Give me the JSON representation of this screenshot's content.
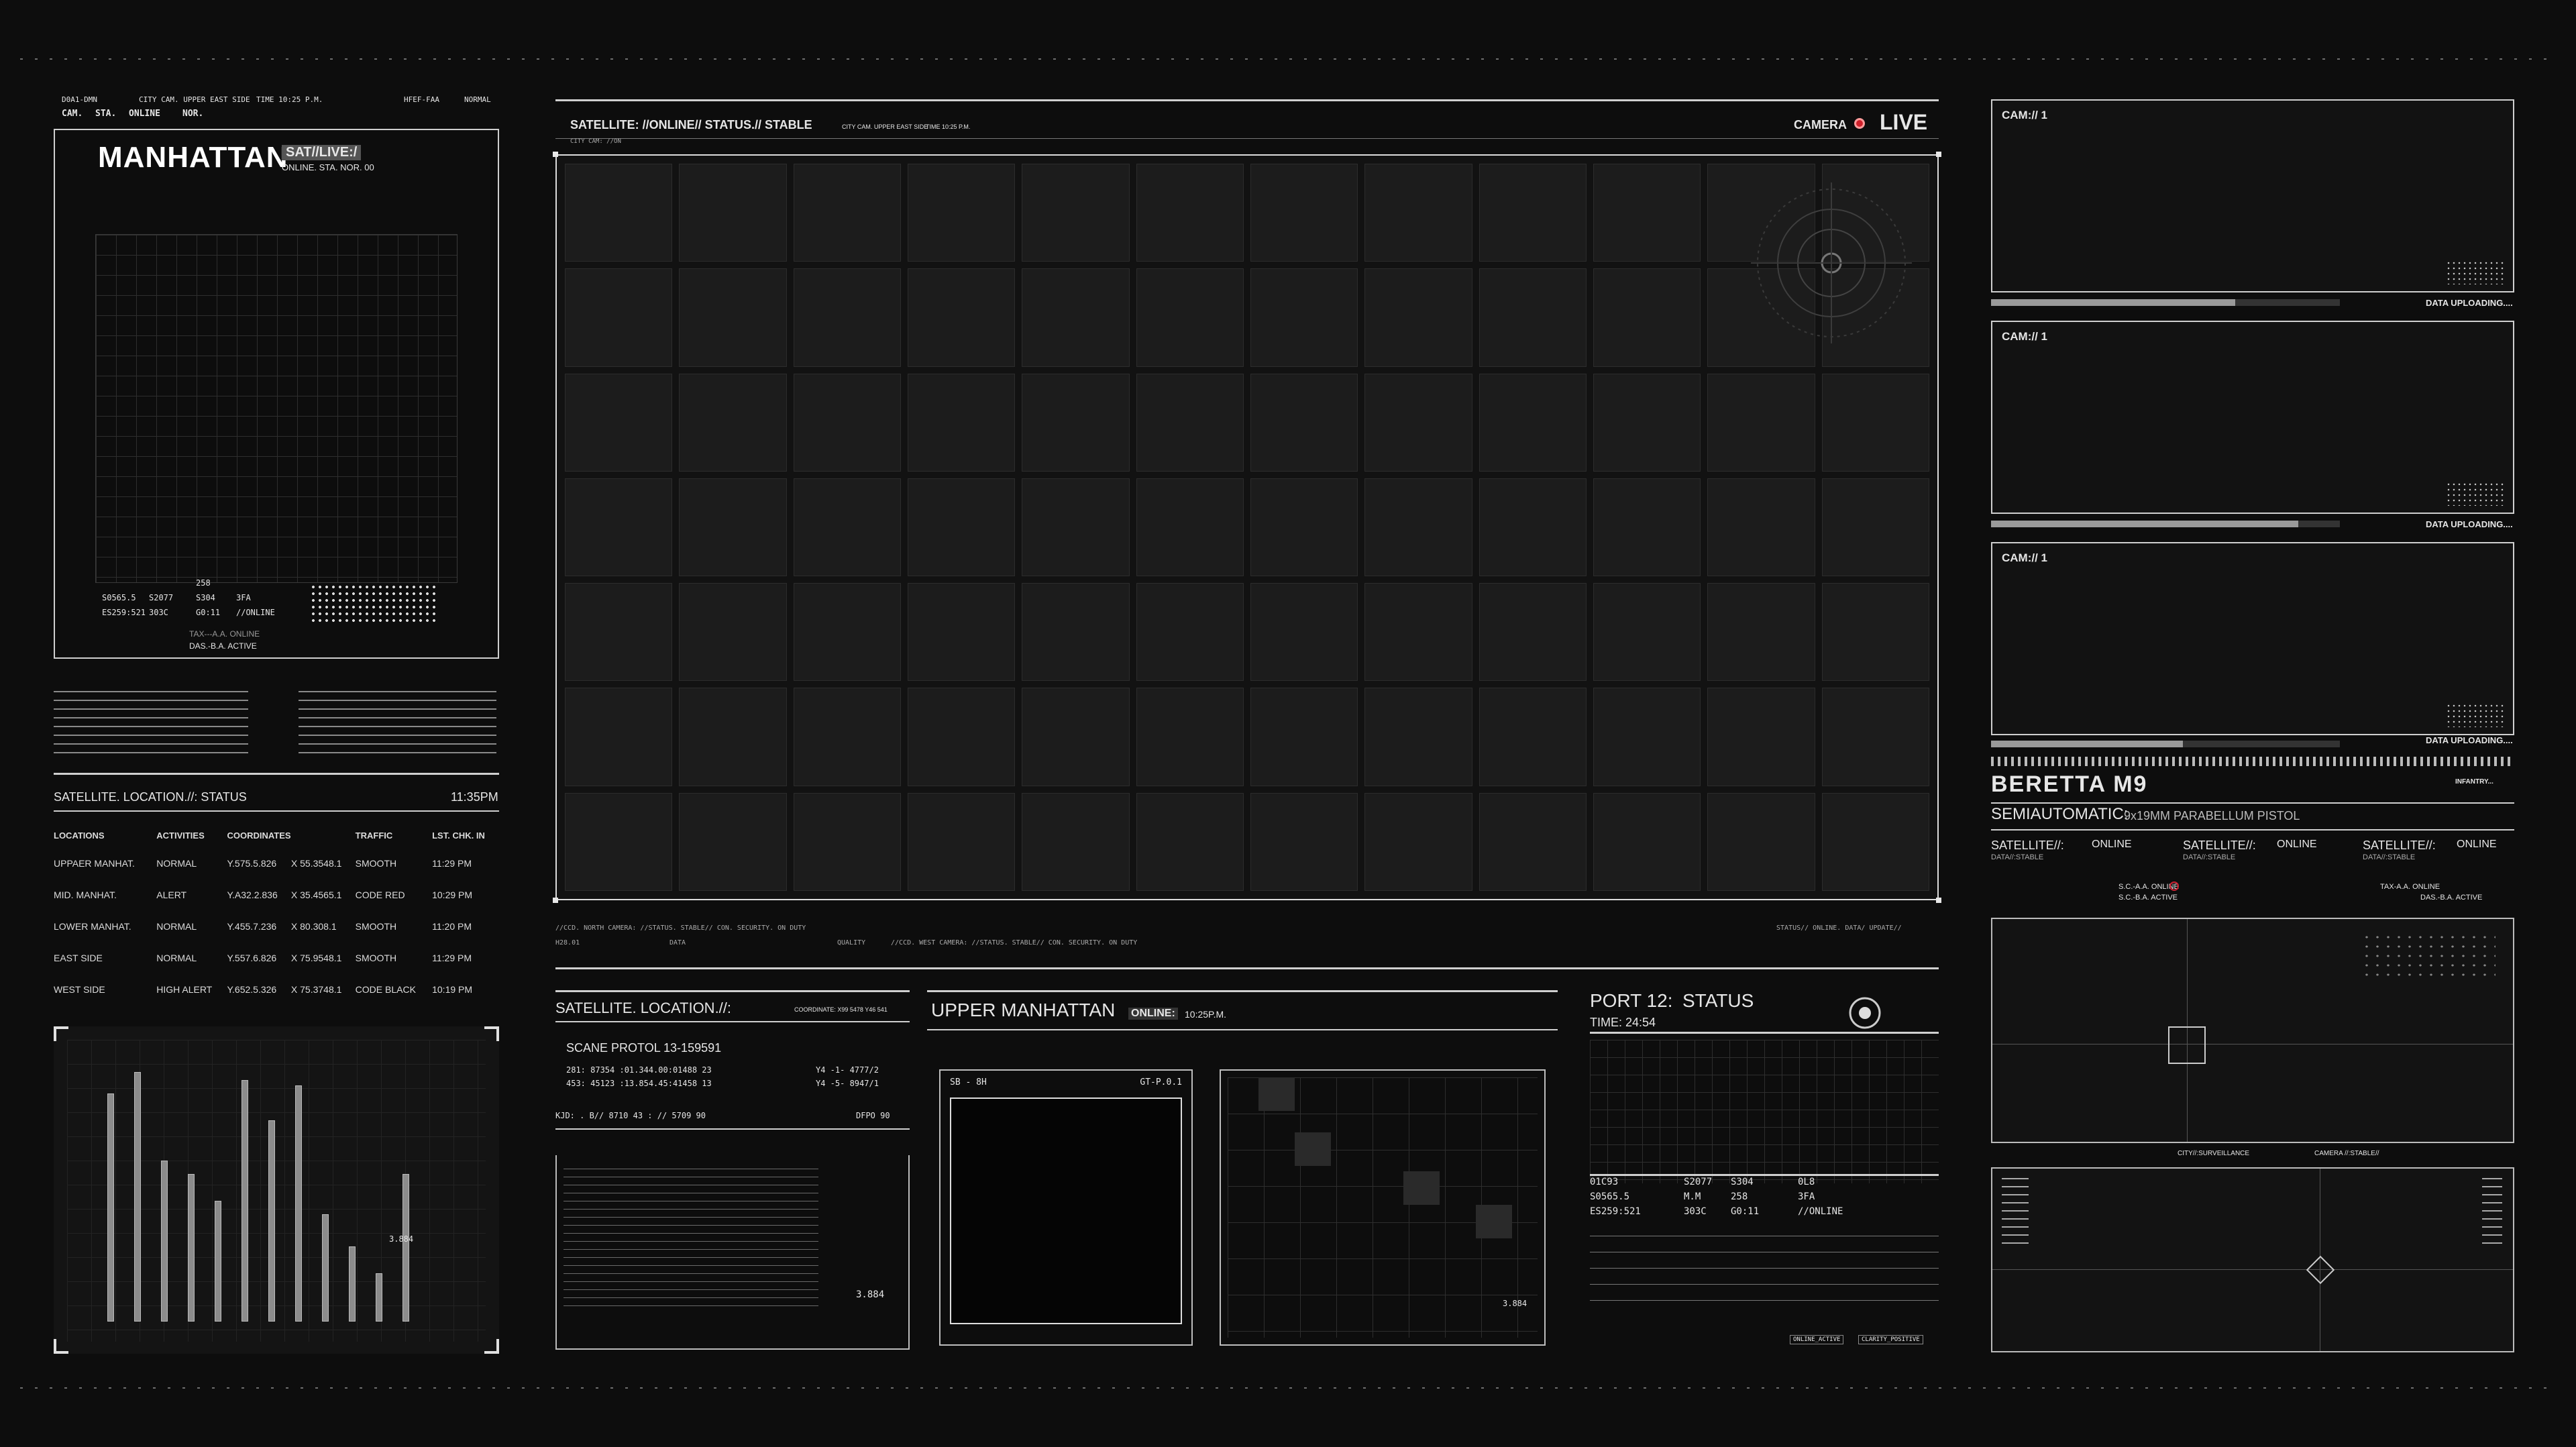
{
  "left_header": {
    "code": "D0A1-DMN",
    "city_cam": "CITY CAM. UPPER EAST SIDE",
    "time": "TIME 10:25 P.M.",
    "hfef": "HFEF-FAA",
    "normal": "NORMAL",
    "cam": "CAM.",
    "sta": "STA.",
    "online": "ONLINE",
    "nor": "NOR."
  },
  "manhattan": {
    "title": "MANHATTAN",
    "tag": "SAT//LIVE:/",
    "sub": "ONLINE. STA. NOR. 00",
    "codes": [
      "S0565.5",
      "ES259:521",
      "S2077",
      "303C",
      "S304",
      "258",
      "G0:11",
      "3FA",
      "//ONLINE"
    ],
    "tax": "TAX---A.A. ONLINE",
    "das": "DAS.-B.A. ACTIVE"
  },
  "location_status": {
    "title": "SATELLITE. LOCATION.//: STATUS",
    "time": "11:35PM",
    "columns": [
      "LOCATIONS",
      "ACTIVITIES",
      "COORDINATES",
      "TRAFFIC",
      "LST. CHK. IN"
    ],
    "rows": [
      [
        "UPPAER MANHAT.",
        "NORMAL",
        "Y.575.5.826",
        "X 55.3548.1",
        "SMOOTH",
        "11:29 PM"
      ],
      [
        "MID. MANHAT.",
        "ALERT",
        "Y.A32.2.836",
        "X 35.4565.1",
        "CODE RED",
        "10:29 PM"
      ],
      [
        "LOWER MANHAT.",
        "NORMAL",
        "Y.455.7.236",
        "X 80.308.1",
        "SMOOTH",
        "11:20 PM"
      ],
      [
        "EAST SIDE",
        "NORMAL",
        "Y.557.6.826",
        "X 75.9548.1",
        "SMOOTH",
        "11:29 PM"
      ],
      [
        "WEST SIDE",
        "HIGH ALERT",
        "Y.652.5.326",
        "X 75.3748.1",
        "CODE BLACK",
        "10:19 PM"
      ]
    ]
  },
  "bars": {
    "label": "3.884",
    "values": [
      0.85,
      0.93,
      0.6,
      0.55,
      0.45,
      0.9,
      0.75,
      0.88,
      0.4,
      0.28,
      0.18,
      0.55
    ]
  },
  "satellite": {
    "header": "SATELLITE: //ONLINE// STATUS.// STABLE",
    "city": "CITY CAM. UPPER EAST SIDE",
    "time": "TIME 10:25 P.M.",
    "camera_label": "CAMERA",
    "live": "LIVE",
    "city_cam_on": "CITY CAM: //ON",
    "footer_left": "//CCD. NORTH CAMERA: //STATUS. STABLE// CON. SECURITY. ON DUTY",
    "footer_mid": "//CCD. WEST CAMERA: //STATUS. STABLE// CON. SECURITY. ON DUTY",
    "footer_right": "STATUS// ONLINE. DATA/ UPDATE//",
    "h28": "H28.01",
    "data": "DATA",
    "quality": "QUALITY"
  },
  "sat_location": {
    "title": "SATELLITE. LOCATION.//:",
    "coordinate": "COORDINATE: X99 5478 Y46 541",
    "scane": "SCANE PROTOL 13-159591",
    "row1": "281: 87354 :01.344.00:01488 23",
    "row1b": "Y4 -1- 4777/2",
    "row2": "453: 45123 :13.854.45:41458 13",
    "row2b": "Y4 -5- 8947/1",
    "kjd": "KJD: .  B// 8710 43 : // 5709 90",
    "dfpo": "DFPO 90",
    "num": "3.884"
  },
  "upper_manhattan": {
    "title": "UPPER MANHATTAN",
    "online": "ONLINE:",
    "time": "10:25P.M.",
    "sb": "SB - 8H",
    "gt": "GT-P.0.1",
    "num": "3.884"
  },
  "port": {
    "title": "PORT 12:",
    "status": "STATUS",
    "time": "TIME: 24:54",
    "codes": [
      "01C93",
      "S2077",
      "S304",
      "0L8",
      "S0565.5",
      "M.M",
      "258",
      "3FA",
      "ES259:521",
      "303C",
      "G0:11",
      "//ONLINE"
    ],
    "online_active": "ONLINE_ACTIVE",
    "clarity": "CLARITY_POSITIVE"
  },
  "cams": [
    {
      "title": "CAM:// 1",
      "status": "DATA UPLOADING....",
      "progress": 0.7
    },
    {
      "title": "CAM:// 1",
      "status": "DATA UPLOADING....",
      "progress": 0.88
    },
    {
      "title": "CAM:// 1",
      "status": "DATA UPLOADING....",
      "progress": 0.55
    }
  ],
  "beretta": {
    "title": "BERETTA M9",
    "type": "SEMIAUTOMATIC:",
    "caliber": "9x19MM PARABELLUM PISTOL",
    "infantry": "INFANTRY...",
    "sat": "SATELLITE//:",
    "online": "ONLINE",
    "data_stable": "DATA//:STABLE",
    "sc": "S.C.-A.A. ONLINE",
    "sc2": "S.C.-B.A. ACTIVE",
    "tax": "TAX-A.A. ONLINE",
    "das": "DAS.-B.A. ACTIVE",
    "surveillance": "CITY//:SURVEILLANCE",
    "camera_stable": "CAMERA //:STABLE//"
  }
}
